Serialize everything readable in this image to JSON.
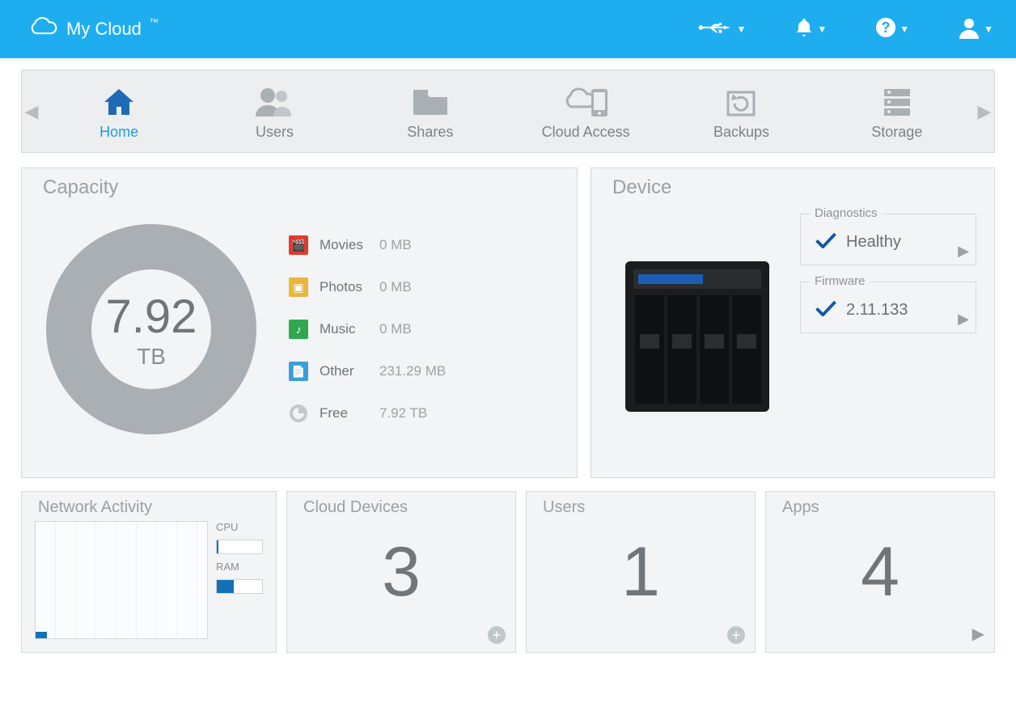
{
  "header": {
    "title": "My Cloud"
  },
  "nav": {
    "items": [
      {
        "label": "Home",
        "active": true
      },
      {
        "label": "Users"
      },
      {
        "label": "Shares"
      },
      {
        "label": "Cloud Access"
      },
      {
        "label": "Backups"
      },
      {
        "label": "Storage"
      }
    ]
  },
  "capacity": {
    "title": "Capacity",
    "value": "7.92",
    "unit": "TB",
    "breakdown": [
      {
        "label": "Movies",
        "value": "0 MB"
      },
      {
        "label": "Photos",
        "value": "0 MB"
      },
      {
        "label": "Music",
        "value": "0 MB"
      },
      {
        "label": "Other",
        "value": "231.29 MB"
      },
      {
        "label": "Free",
        "value": "7.92 TB"
      }
    ]
  },
  "device": {
    "title": "Device",
    "diagnostics": {
      "label": "Diagnostics",
      "status": "Healthy"
    },
    "firmware": {
      "label": "Firmware",
      "version": "2.11.133"
    }
  },
  "network_activity": {
    "title": "Network Activity",
    "cpu_label": "CPU",
    "ram_label": "RAM",
    "cpu_pct": 4,
    "ram_pct": 38
  },
  "cloud_devices": {
    "title": "Cloud Devices",
    "count": "3"
  },
  "users": {
    "title": "Users",
    "count": "1"
  },
  "apps": {
    "title": "Apps",
    "count": "4"
  }
}
